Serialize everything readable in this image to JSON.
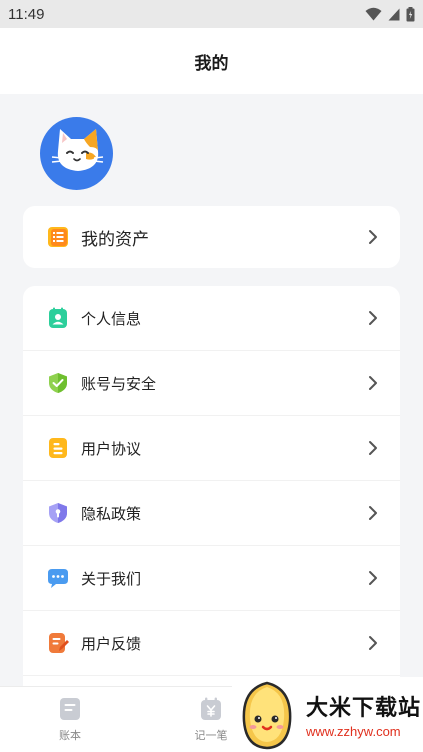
{
  "status_bar": {
    "time": "11:49"
  },
  "nav": {
    "title": "我的"
  },
  "profile": {
    "avatar": "cat-avatar-icon"
  },
  "asset": {
    "label": "我的资产",
    "icon": "list-icon"
  },
  "menu": [
    {
      "label": "个人信息",
      "icon": "person-card-icon",
      "color": "#2ccf9b"
    },
    {
      "label": "账号与安全",
      "icon": "shield-check-icon",
      "color": "#8fd14f"
    },
    {
      "label": "用户协议",
      "icon": "document-icon",
      "color": "#ffb81c"
    },
    {
      "label": "隐私政策",
      "icon": "privacy-shield-icon",
      "color": "#8c86f0"
    },
    {
      "label": "关于我们",
      "icon": "chat-bubble-icon",
      "color": "#4a9bf0"
    },
    {
      "label": "用户反馈",
      "icon": "feedback-edit-icon",
      "color": "#f07a3a"
    }
  ],
  "tabs": [
    {
      "label": "账本",
      "icon": "ledger-icon"
    },
    {
      "label": "记一笔",
      "icon": "calendar-yen-icon"
    }
  ],
  "watermark": {
    "title": "大米下载站",
    "url": "www.zzhyw.com"
  }
}
